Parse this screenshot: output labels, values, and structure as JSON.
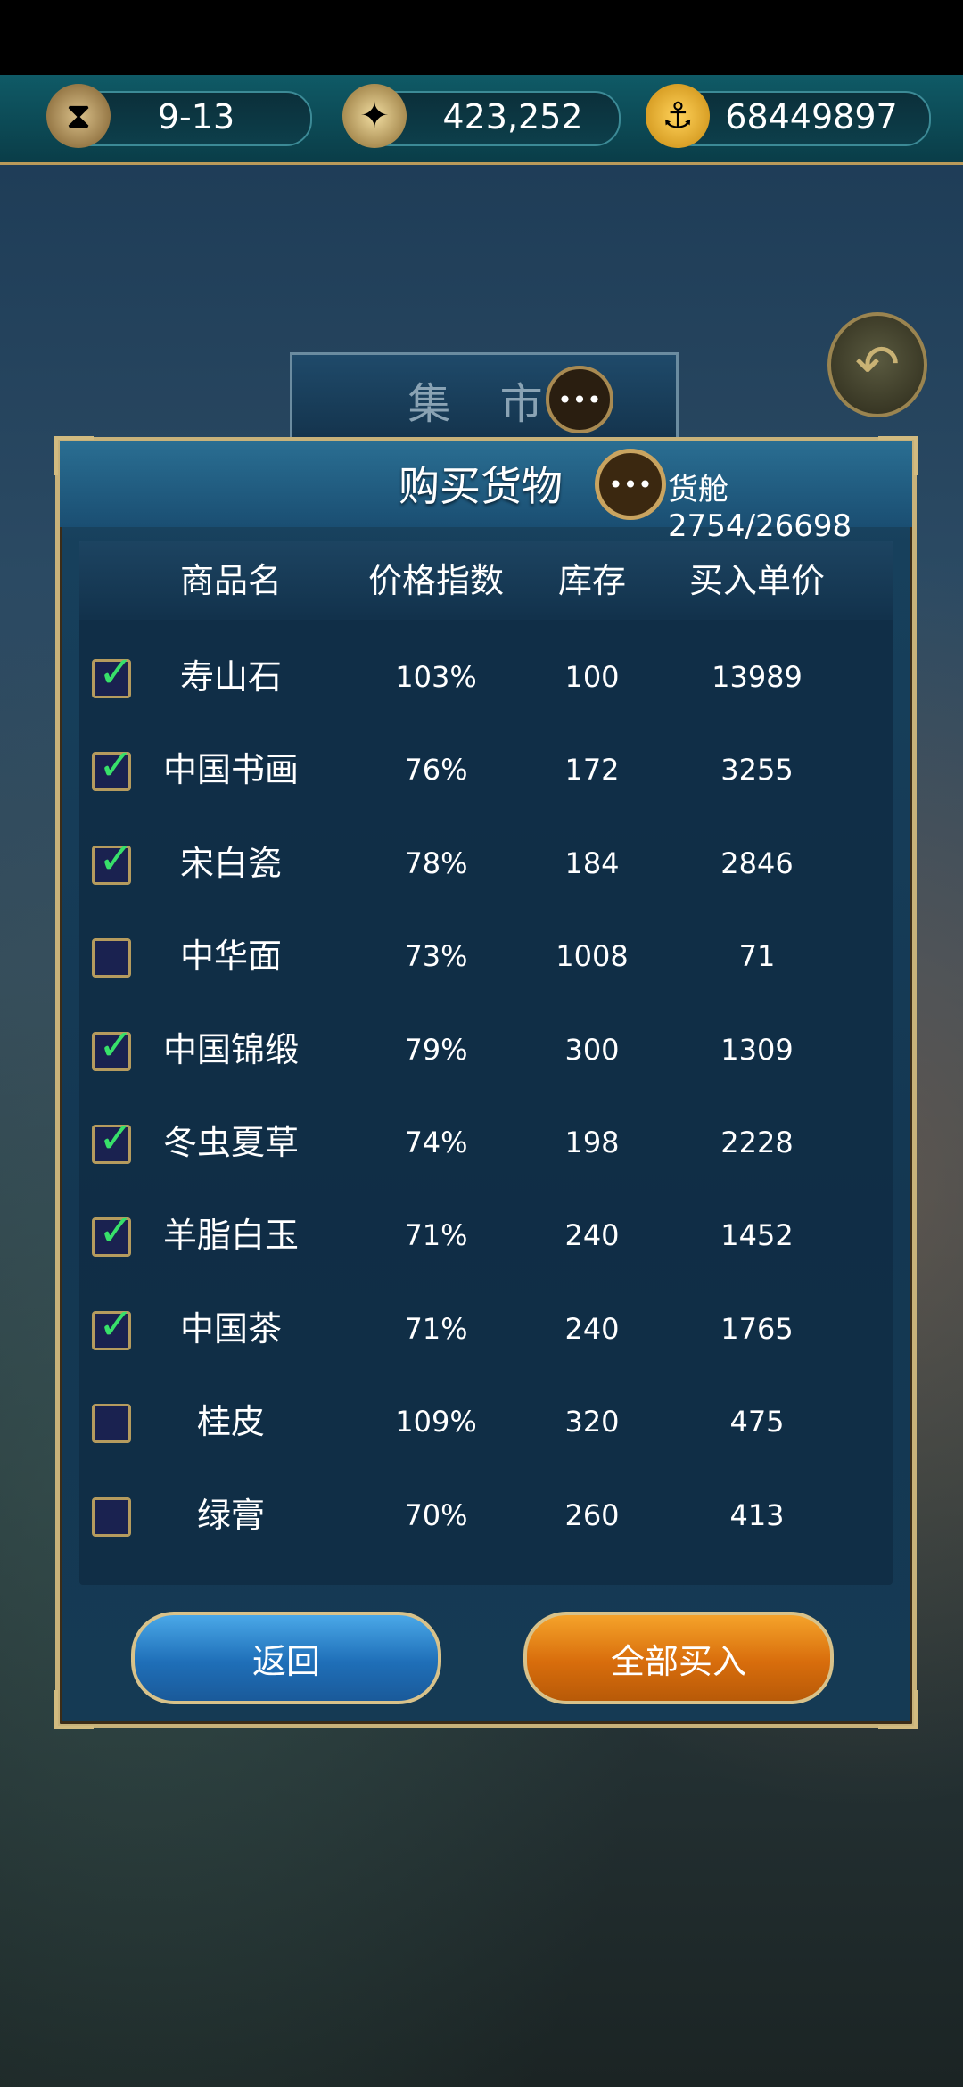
{
  "resources": {
    "date": "9-13",
    "compass_value": "423,252",
    "gold": "68449897",
    "icons": [
      "hourglass-icon",
      "compass-icon",
      "gold-coin-icon"
    ]
  },
  "market_sign": "集 市",
  "dialog": {
    "title": "购买货物",
    "cargo": "货舱2754/26698",
    "headers": [
      "商品名",
      "价格指数",
      "库存",
      "买入单价"
    ],
    "rows": [
      {
        "checked": true,
        "name": "寿山石",
        "price_index": "103%",
        "stock": "100",
        "unit_price": "13989"
      },
      {
        "checked": true,
        "name": "中国书画",
        "price_index": "76%",
        "stock": "172",
        "unit_price": "3255"
      },
      {
        "checked": true,
        "name": "宋白瓷",
        "price_index": "78%",
        "stock": "184",
        "unit_price": "2846"
      },
      {
        "checked": false,
        "name": "中华面",
        "price_index": "73%",
        "stock": "1008",
        "unit_price": "71"
      },
      {
        "checked": true,
        "name": "中国锦缎",
        "price_index": "79%",
        "stock": "300",
        "unit_price": "1309"
      },
      {
        "checked": true,
        "name": "冬虫夏草",
        "price_index": "74%",
        "stock": "198",
        "unit_price": "2228"
      },
      {
        "checked": true,
        "name": "羊脂白玉",
        "price_index": "71%",
        "stock": "240",
        "unit_price": "1452"
      },
      {
        "checked": true,
        "name": "中国茶",
        "price_index": "71%",
        "stock": "240",
        "unit_price": "1765"
      },
      {
        "checked": false,
        "name": "桂皮",
        "price_index": "109%",
        "stock": "320",
        "unit_price": "475"
      },
      {
        "checked": false,
        "name": "绿膏",
        "price_index": "70%",
        "stock": "260",
        "unit_price": "413"
      }
    ],
    "back_label": "返回",
    "buy_all_label": "全部买入"
  },
  "colors": {
    "check": "#38e06a",
    "back_button": "#1f6fb8",
    "buy_all_button": "#d86d0c",
    "frame_gold": "#c8b27a"
  }
}
